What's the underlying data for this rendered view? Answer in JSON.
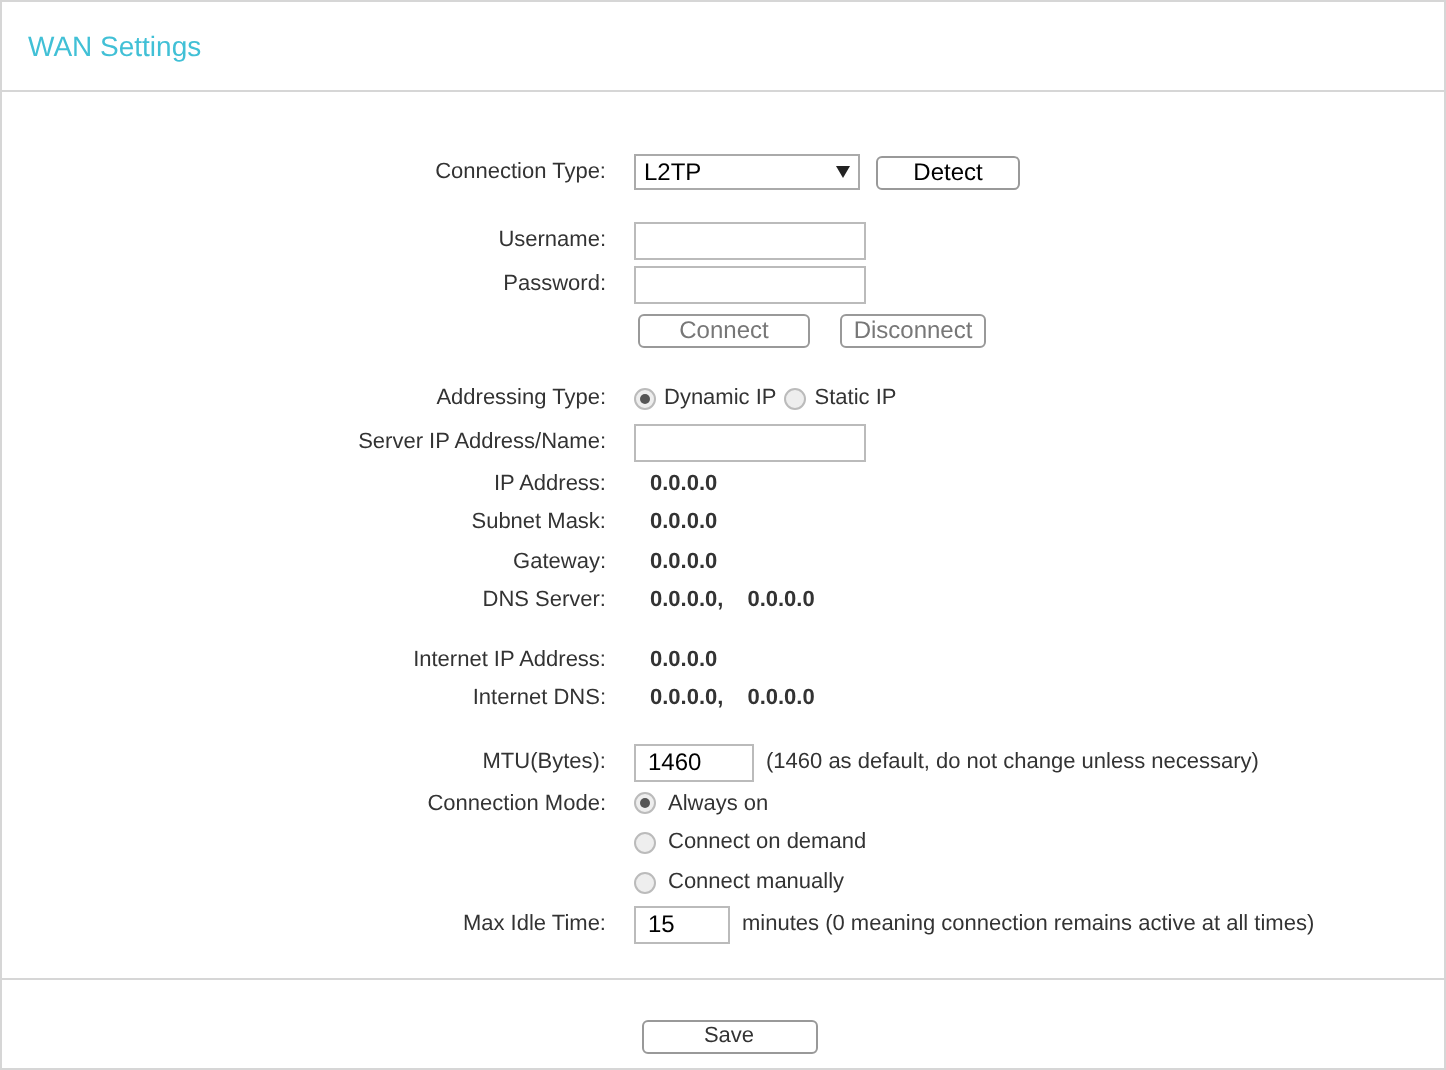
{
  "title": "WAN Settings",
  "sections": [
    [
      {
        "kind": "select",
        "label": "Connection Type:",
        "value": "L2TP",
        "button": "Detect"
      }
    ],
    [
      {
        "kind": "input",
        "label": "Username:"
      },
      {
        "kind": "input",
        "label": "Password:"
      },
      {
        "kind": "buttons",
        "buttons": [
          "Connect",
          "Disconnect"
        ]
      }
    ],
    [
      {
        "kind": "radios",
        "label": "Addressing Type:",
        "options": [
          {
            "label": "Dynamic IP",
            "selected": true
          },
          {
            "label": "Static IP",
            "selected": false
          }
        ]
      },
      {
        "kind": "input",
        "label": "Server IP Address/Name:"
      },
      {
        "kind": "values",
        "label": "IP Address:",
        "values": [
          "0.0.0.0"
        ]
      },
      {
        "kind": "values",
        "label": "Subnet Mask:",
        "values": [
          "0.0.0.0"
        ]
      },
      {
        "kind": "values",
        "label": "Gateway:",
        "values": [
          "0.0.0.0"
        ]
      },
      {
        "kind": "values",
        "label": "DNS Server:",
        "values": [
          "0.0.0.0,",
          "0.0.0.0"
        ]
      }
    ],
    [
      {
        "kind": "values",
        "label": "Internet IP Address:",
        "values": [
          "0.0.0.0"
        ]
      },
      {
        "kind": "values",
        "label": "Internet DNS:",
        "values": [
          "0.0.0.0,",
          "0.0.0.0"
        ]
      }
    ],
    [
      {
        "kind": "input",
        "label": "MTU(Bytes):",
        "value": "1460",
        "note": "(1460 as default, do not change unless necessary)"
      },
      {
        "kind": "radio_list",
        "label": "Connection Mode:",
        "options": [
          {
            "label": "Always on",
            "selected": true
          },
          {
            "label": "Connect on demand",
            "selected": false
          },
          {
            "label": "Connect manually",
            "selected": false
          }
        ]
      },
      {
        "kind": "input",
        "label": "Max Idle Time:",
        "value": "15",
        "note": "minutes (0 meaning connection remains active at all times)"
      }
    ]
  ],
  "save": "Save"
}
